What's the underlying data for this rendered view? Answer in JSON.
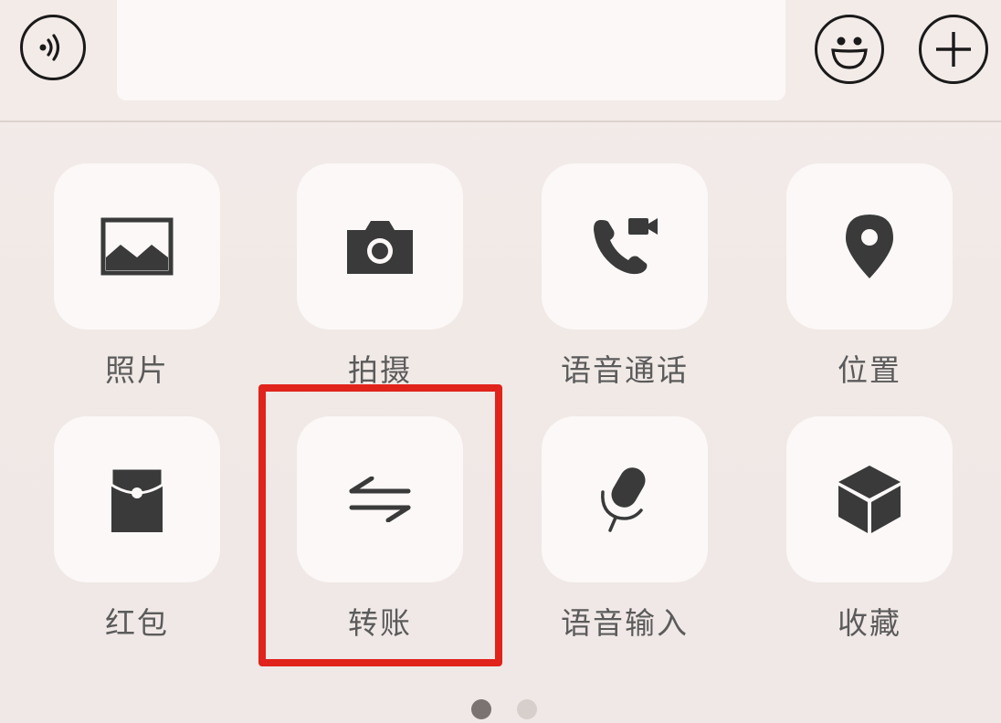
{
  "input_bar": {
    "voice_icon": "voice-wave-icon",
    "emoji_icon": "smiley-icon",
    "plus_icon": "plus-circle-icon",
    "text_value": ""
  },
  "panel": {
    "items": [
      {
        "label": "照片",
        "icon": "photo-icon"
      },
      {
        "label": "拍摄",
        "icon": "camera-icon"
      },
      {
        "label": "语音通话",
        "icon": "phone-video-call-icon"
      },
      {
        "label": "位置",
        "icon": "location-pin-icon"
      },
      {
        "label": "红包",
        "icon": "red-packet-icon"
      },
      {
        "label": "转账",
        "icon": "transfer-arrows-icon"
      },
      {
        "label": "语音输入",
        "icon": "microphone-icon"
      },
      {
        "label": "收藏",
        "icon": "favorites-cube-icon"
      }
    ],
    "highlighted_item": "转账",
    "highlight_color": "#e0231b",
    "page_indicator": {
      "current": 1,
      "total": 2
    }
  }
}
